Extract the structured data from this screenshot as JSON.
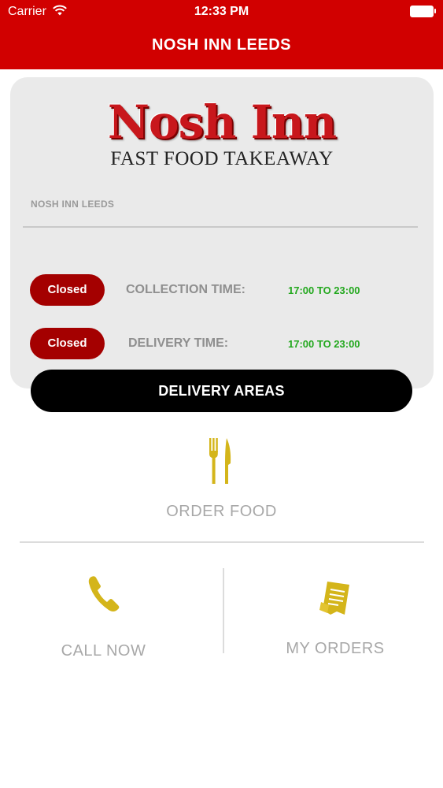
{
  "status_bar": {
    "carrier": "Carrier",
    "time": "12:33 PM"
  },
  "header": {
    "title": "NOSH INN LEEDS"
  },
  "card": {
    "logo_name": "Nosh Inn",
    "logo_tagline": "FAST FOOD TAKEAWAY",
    "branch_label": "NOSH INN LEEDS",
    "rows": [
      {
        "status": "Closed",
        "label": "COLLECTION TIME:",
        "time": "17:00 TO 23:00"
      },
      {
        "status": "Closed",
        "label": "DELIVERY TIME:",
        "time": "17:00 TO 23:00"
      }
    ]
  },
  "delivery_button": {
    "label": "DELIVERY AREAS"
  },
  "menu": {
    "order_food": {
      "label": "ORDER FOOD",
      "icon": "fork-knife-icon"
    },
    "call_now": {
      "label": "CALL NOW",
      "icon": "phone-icon"
    },
    "my_orders": {
      "label": "MY ORDERS",
      "icon": "receipt-icon"
    }
  },
  "colors": {
    "header_red": "#d10000",
    "status_pill": "#a40000",
    "time_green": "#23a81e",
    "icon_gold": "#d4b51a",
    "button_black": "#000000"
  }
}
